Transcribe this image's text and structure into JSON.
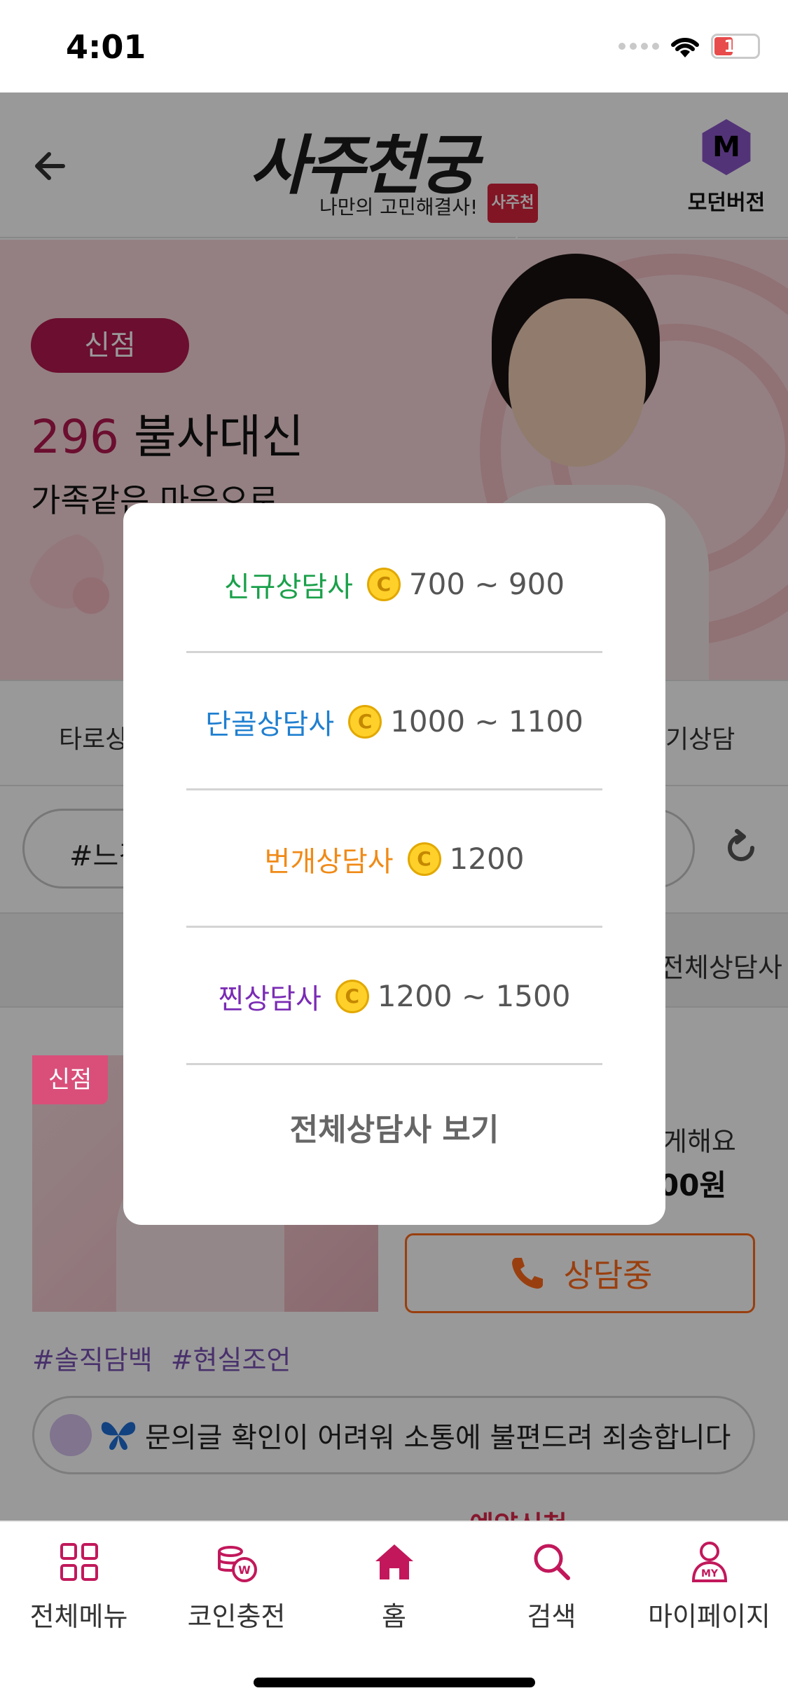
{
  "status_bar": {
    "time": "4:01",
    "battery": "16"
  },
  "header": {
    "logo_title": "사주천궁",
    "logo_tagline": "나만의 고민해결사!",
    "logo_seal": "사주천궁",
    "modern_letter": "M",
    "modern_label": "모던버전"
  },
  "banner": {
    "badge": "신점",
    "number": "296",
    "name": "불사대신",
    "subtitle": "가족같은 마음으로"
  },
  "tabs": {
    "left": "타로상",
    "right": "기상담"
  },
  "filter": {
    "search_text": "#느김"
  },
  "sort": {
    "right": "전체상담사"
  },
  "card": {
    "badge": "신점",
    "message": "게해요",
    "price": "00원",
    "call_label": "상담중",
    "tags": [
      "#솔직담백",
      "#현실조언"
    ],
    "notice": "문의글 확인이 어려워 소통에 불편드려 죄송합니다",
    "partial_alert": "예약신청"
  },
  "modal": {
    "items": [
      {
        "label": "신규상담사",
        "range": "700 ~ 900",
        "color": "#1aa04a"
      },
      {
        "label": "단골상담사",
        "range": "1000 ~ 1100",
        "color": "#1f7fd0"
      },
      {
        "label": "번개상담사",
        "range": "1200",
        "color": "#f08a16"
      },
      {
        "label": "찐상담사",
        "range": "1200 ~ 1500",
        "color": "#7a2bb5"
      }
    ],
    "coin_symbol": "C",
    "view_all": "전체상담사 보기"
  },
  "bottom_nav": [
    {
      "label": "전체메뉴",
      "icon": "grid-icon"
    },
    {
      "label": "코인충전",
      "icon": "coin-charge-icon"
    },
    {
      "label": "홈",
      "icon": "home-icon"
    },
    {
      "label": "검색",
      "icon": "search-icon"
    },
    {
      "label": "마이페이지",
      "icon": "my-page-icon"
    }
  ],
  "colors": {
    "brand": "#b2184f",
    "nav_icon": "#c2185b"
  }
}
